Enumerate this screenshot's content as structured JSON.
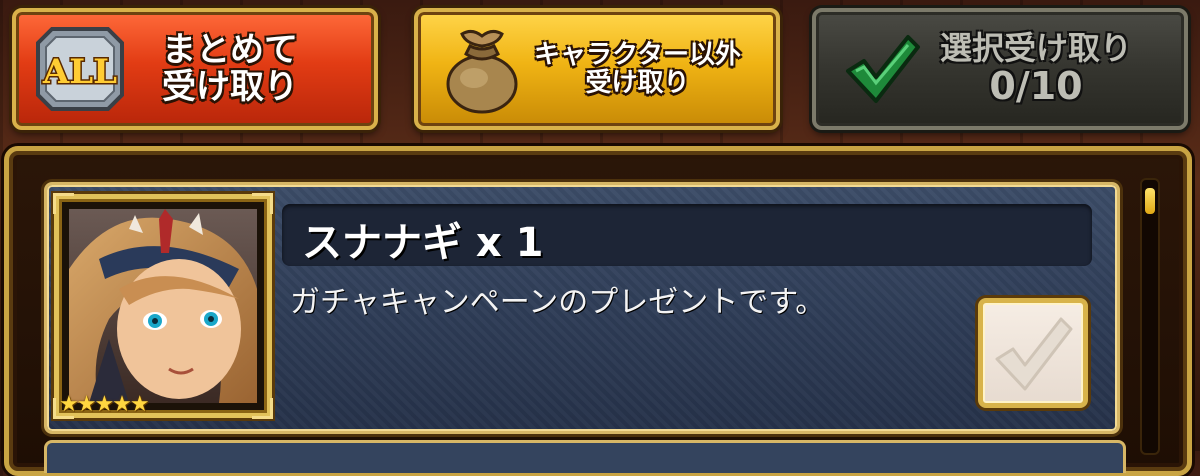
{
  "toolbar": {
    "collect_all": {
      "label_line1": "まとめて",
      "label_line2": "受け取り",
      "icon": "all-badge-icon",
      "icon_text": "ALL"
    },
    "collect_non_character": {
      "label_line1": "キャラクター以外",
      "label_line2": "受け取り",
      "icon": "money-bag-icon"
    },
    "collect_selected": {
      "label_line1": "選択受け取り",
      "count": "0/10",
      "icon": "checkmark-icon"
    }
  },
  "present_list": {
    "items": [
      {
        "name": "スナナギ x 1",
        "description": "ガチャキャンペーンのプレゼントです。",
        "rarity_stars": "★★★★★",
        "selected": false
      }
    ]
  },
  "colors": {
    "collect_all_button": "#e23c14",
    "collect_non_character_button": "#f0b414",
    "collect_selected_button": "#35352f",
    "card_background": "#2e3c56",
    "gold_border": "#d7b766"
  }
}
